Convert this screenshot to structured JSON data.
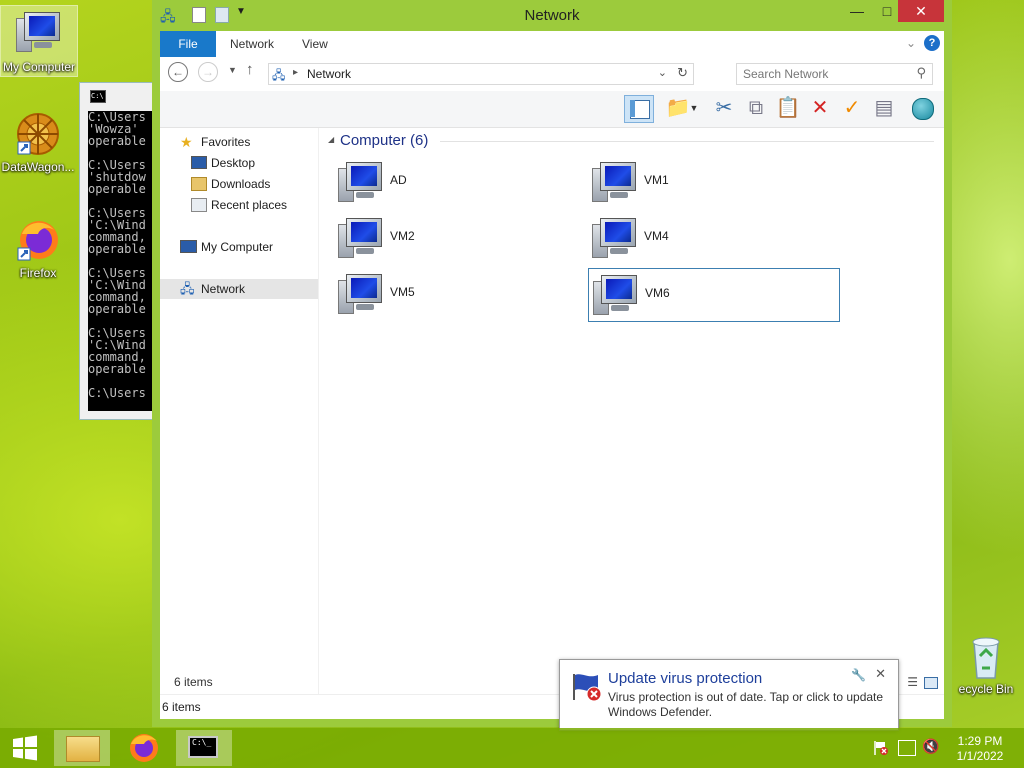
{
  "desktop": {
    "icons": [
      {
        "label": "My Computer"
      },
      {
        "label": "DataWagon..."
      },
      {
        "label": "Firefox"
      },
      {
        "label": "ecycle Bin"
      }
    ]
  },
  "cmd": {
    "lines": [
      "C:\\Users",
      "'Wowza'",
      "operable",
      "",
      "C:\\Users",
      "'shutdow",
      "operable",
      "",
      "C:\\Users",
      "'C:\\Wind",
      "command,",
      "operable",
      "",
      "C:\\Users",
      "'C:\\Wind",
      "command,",
      "operable",
      "",
      "C:\\Users",
      "'C:\\Wind",
      "command,",
      "operable",
      "",
      "C:\\Users"
    ]
  },
  "explorer": {
    "title": "Network",
    "tabs": {
      "file": "File",
      "network": "Network",
      "view": "View"
    },
    "address": {
      "location": "Network"
    },
    "search": {
      "placeholder": "Search Network"
    },
    "nav": {
      "favorites": "Favorites",
      "desktop": "Desktop",
      "downloads": "Downloads",
      "recent": "Recent places",
      "my_computer": "My Computer",
      "network": "Network"
    },
    "group_header": "Computer (6)",
    "items": [
      "AD",
      "VM1",
      "VM2",
      "VM4",
      "VM5",
      "VM6"
    ],
    "status_inner": "6 items",
    "status_outer": "6 items"
  },
  "toast": {
    "title": "Update virus protection",
    "message": "Virus protection is out of date. Tap or click to update Windows Defender."
  },
  "clock": {
    "time": "1:29 PM",
    "date": "1/1/2022"
  }
}
